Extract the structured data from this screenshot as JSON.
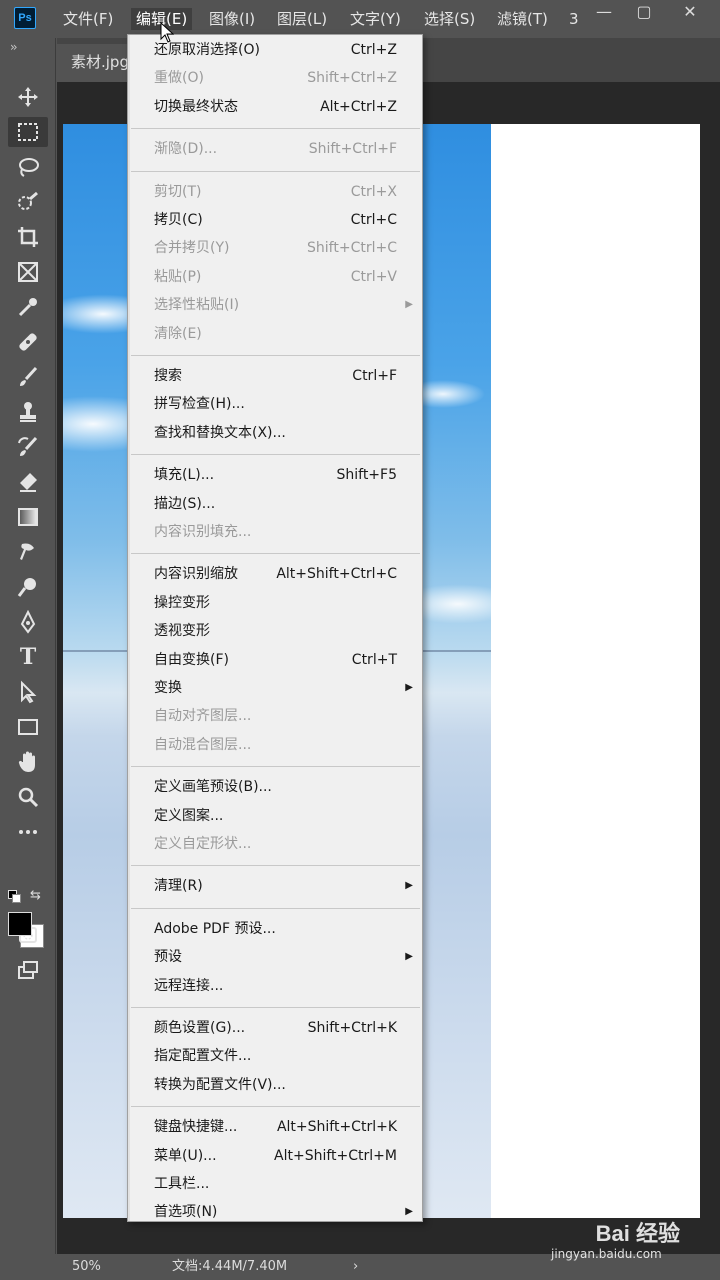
{
  "app": {
    "logo": "Ps"
  },
  "menubar": {
    "items": [
      "文件(F)",
      "编辑(E)",
      "图像(I)",
      "图层(L)",
      "文字(Y)",
      "选择(S)",
      "滤镜(T)",
      "3"
    ],
    "active": "编辑(E)"
  },
  "window_controls": {
    "minimize": "—",
    "maximize": "▢",
    "close": "✕"
  },
  "document": {
    "tab": "素材.jpg"
  },
  "tools": [
    "move-tool",
    "marquee-tool",
    "lasso-tool",
    "quick-select-tool",
    "crop-tool",
    "frame-tool",
    "eyedropper-tool",
    "healing-tool",
    "brush-tool",
    "stamp-tool",
    "history-brush-tool",
    "eraser-tool",
    "gradient-tool",
    "smudge-tool",
    "dodge-tool",
    "pen-tool",
    "type-tool",
    "path-select-tool",
    "shape-tool",
    "hand-tool",
    "zoom-tool",
    "more-tools",
    "quick-mask",
    "screen-mode"
  ],
  "colors": {
    "foreground": "#000000",
    "background": "#ffffff",
    "accent": "#31a8ff",
    "menu_bg": "#f0f0f0",
    "ui_bg": "#535353"
  },
  "edit_menu": {
    "groups": [
      [
        {
          "label": "还原取消选择(O)",
          "shortcut": "Ctrl+Z",
          "enabled": true
        },
        {
          "label": "重做(O)",
          "shortcut": "Shift+Ctrl+Z",
          "enabled": false
        },
        {
          "label": "切换最终状态",
          "shortcut": "Alt+Ctrl+Z",
          "enabled": true
        }
      ],
      [
        {
          "label": "渐隐(D)...",
          "shortcut": "Shift+Ctrl+F",
          "enabled": false
        }
      ],
      [
        {
          "label": "剪切(T)",
          "shortcut": "Ctrl+X",
          "enabled": false
        },
        {
          "label": "拷贝(C)",
          "shortcut": "Ctrl+C",
          "enabled": true
        },
        {
          "label": "合并拷贝(Y)",
          "shortcut": "Shift+Ctrl+C",
          "enabled": false
        },
        {
          "label": "粘贴(P)",
          "shortcut": "Ctrl+V",
          "enabled": false
        },
        {
          "label": "选择性粘贴(I)",
          "shortcut": "",
          "enabled": false,
          "submenu": true
        },
        {
          "label": "清除(E)",
          "shortcut": "",
          "enabled": false
        }
      ],
      [
        {
          "label": "搜索",
          "shortcut": "Ctrl+F",
          "enabled": true
        },
        {
          "label": "拼写检查(H)...",
          "shortcut": "",
          "enabled": true
        },
        {
          "label": "查找和替换文本(X)...",
          "shortcut": "",
          "enabled": true
        }
      ],
      [
        {
          "label": "填充(L)...",
          "shortcut": "Shift+F5",
          "enabled": true
        },
        {
          "label": "描边(S)...",
          "shortcut": "",
          "enabled": true
        },
        {
          "label": "内容识别填充...",
          "shortcut": "",
          "enabled": false
        }
      ],
      [
        {
          "label": "内容识别缩放",
          "shortcut": "Alt+Shift+Ctrl+C",
          "enabled": true
        },
        {
          "label": "操控变形",
          "shortcut": "",
          "enabled": true
        },
        {
          "label": "透视变形",
          "shortcut": "",
          "enabled": true
        },
        {
          "label": "自由变换(F)",
          "shortcut": "Ctrl+T",
          "enabled": true
        },
        {
          "label": "变换",
          "shortcut": "",
          "enabled": true,
          "submenu": true
        },
        {
          "label": "自动对齐图层...",
          "shortcut": "",
          "enabled": false
        },
        {
          "label": "自动混合图层...",
          "shortcut": "",
          "enabled": false
        }
      ],
      [
        {
          "label": "定义画笔预设(B)...",
          "shortcut": "",
          "enabled": true
        },
        {
          "label": "定义图案...",
          "shortcut": "",
          "enabled": true
        },
        {
          "label": "定义自定形状...",
          "shortcut": "",
          "enabled": false
        }
      ],
      [
        {
          "label": "清理(R)",
          "shortcut": "",
          "enabled": true,
          "submenu": true
        }
      ],
      [
        {
          "label": "Adobe PDF 预设...",
          "shortcut": "",
          "enabled": true
        },
        {
          "label": "预设",
          "shortcut": "",
          "enabled": true,
          "submenu": true
        },
        {
          "label": "远程连接...",
          "shortcut": "",
          "enabled": true
        }
      ],
      [
        {
          "label": "颜色设置(G)...",
          "shortcut": "Shift+Ctrl+K",
          "enabled": true
        },
        {
          "label": "指定配置文件...",
          "shortcut": "",
          "enabled": true
        },
        {
          "label": "转换为配置文件(V)...",
          "shortcut": "",
          "enabled": true
        }
      ],
      [
        {
          "label": "键盘快捷键...",
          "shortcut": "Alt+Shift+Ctrl+K",
          "enabled": true
        },
        {
          "label": "菜单(U)...",
          "shortcut": "Alt+Shift+Ctrl+M",
          "enabled": true
        },
        {
          "label": "工具栏...",
          "shortcut": "",
          "enabled": true
        },
        {
          "label": "首选项(N)",
          "shortcut": "",
          "enabled": true,
          "submenu": true
        }
      ]
    ]
  },
  "status": {
    "zoom": "50%",
    "doc_info": "文档:4.44M/7.40M",
    "arrow": "›"
  },
  "watermark": {
    "brand": "Bai 经验",
    "url": "jingyan.baidu.com"
  }
}
